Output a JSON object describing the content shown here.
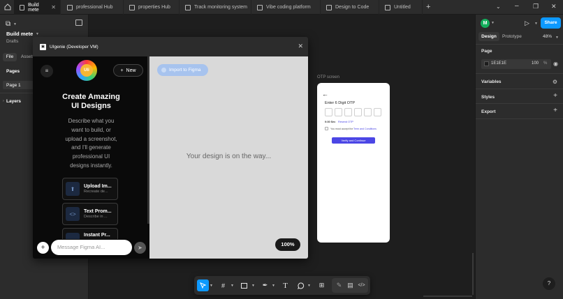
{
  "tabs": [
    {
      "label": "Build mete",
      "active": true
    },
    {
      "label": "professional Hub"
    },
    {
      "label": "properties Hub"
    },
    {
      "label": "Track monitoring system"
    },
    {
      "label": "Vibe coding platform"
    },
    {
      "label": "Design to Code"
    },
    {
      "label": "Untitled"
    }
  ],
  "left_panel": {
    "file_name": "Build mete",
    "location": "Drafts",
    "tab_file": "File",
    "tab_assets": "Assets",
    "pages_title": "Pages",
    "page_1": "Page 1",
    "layers_title": "Layers"
  },
  "right_panel": {
    "avatar_letter": "M",
    "share_label": "Share",
    "tab_design": "Design",
    "tab_prototype": "Prototype",
    "zoom": "48%",
    "page_title": "Page",
    "page_color": "1E1E1E",
    "page_opacity": "100",
    "percent_sign": "%",
    "variables": "Variables",
    "styles": "Styles",
    "export": "Export"
  },
  "plugin": {
    "title": "UIgenie (Developer VM)",
    "new_label": "New",
    "logo_text": "Uli",
    "headline_1": "Create Amazing",
    "headline_2": "UI Designs",
    "desc_1": "Describe what you",
    "desc_2": "want to build, or",
    "desc_3": "upload a screenshot,",
    "desc_4": "and I'll generate",
    "desc_5": "professional UI",
    "desc_6": "designs instantly.",
    "cards": [
      {
        "title": "Upload Im...",
        "sub": "Recreate de..."
      },
      {
        "title": "Text Prom...",
        "sub": "Describe in ..."
      },
      {
        "title": "Instant Pr...",
        "sub": ""
      }
    ],
    "input_placeholder": "Message Figma AI...",
    "import_label": "Import to Figma",
    "preview_text": "Your design is on the way...",
    "preview_zoom": "100%"
  },
  "otp_frame": {
    "label": "OTP screen",
    "heading": "Enter 6 Digit OTP",
    "timer": "0:30 Sec",
    "resend": "Resend OTP",
    "accept_prefix": "You must accept the",
    "terms": "Term and Conditions",
    "button": "Verify and Continue"
  },
  "colors": {
    "accent": "#0d99ff",
    "otp_button": "#4b46e5",
    "link": "#4b46e5"
  }
}
